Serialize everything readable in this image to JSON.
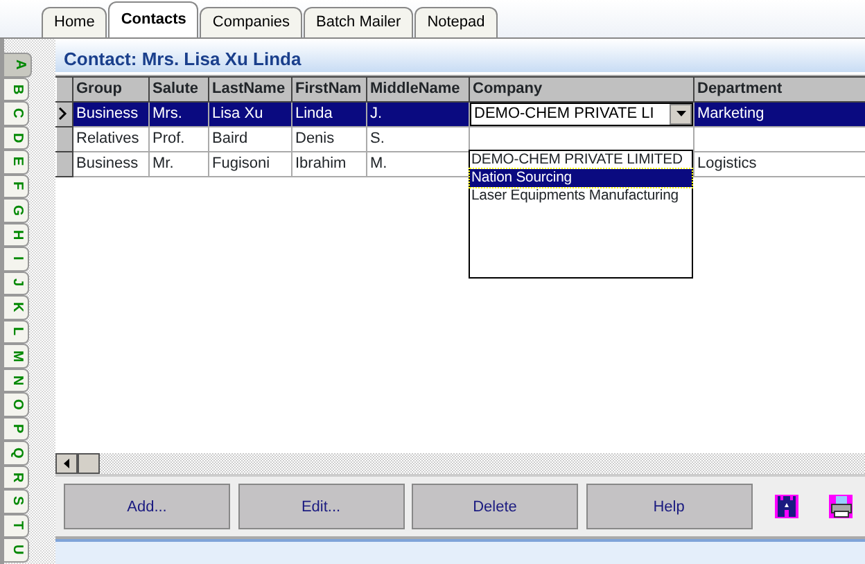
{
  "tabs": [
    {
      "label": "Home",
      "selected": false
    },
    {
      "label": "Contacts",
      "selected": true
    },
    {
      "label": "Companies",
      "selected": false
    },
    {
      "label": "Batch Mailer",
      "selected": false
    },
    {
      "label": "Notepad",
      "selected": false
    }
  ],
  "letters": [
    {
      "label": "A",
      "selected": true
    },
    {
      "label": "B",
      "selected": false
    },
    {
      "label": "C",
      "selected": false
    },
    {
      "label": "D",
      "selected": false
    },
    {
      "label": "E",
      "selected": false
    },
    {
      "label": "F",
      "selected": false
    },
    {
      "label": "G",
      "selected": false
    },
    {
      "label": "H",
      "selected": false
    },
    {
      "label": "I",
      "selected": false
    },
    {
      "label": "J",
      "selected": false
    },
    {
      "label": "K",
      "selected": false
    },
    {
      "label": "L",
      "selected": false
    },
    {
      "label": "M",
      "selected": false
    },
    {
      "label": "N",
      "selected": false
    },
    {
      "label": "O",
      "selected": false
    },
    {
      "label": "P",
      "selected": false
    },
    {
      "label": "Q",
      "selected": false
    },
    {
      "label": "R",
      "selected": false
    },
    {
      "label": "S",
      "selected": false
    },
    {
      "label": "T",
      "selected": false
    },
    {
      "label": "U",
      "selected": false
    }
  ],
  "header": {
    "title": "Contact: Mrs. Lisa Xu Linda"
  },
  "table": {
    "columns": [
      "Group",
      "Salute",
      "LastName",
      "FirstNam",
      "MiddleName",
      "Company",
      "Department"
    ],
    "rows": [
      {
        "selected": true,
        "group": "Business",
        "salute": "Mrs.",
        "last_name": "Lisa Xu",
        "first_name": "Linda",
        "middle_name": "J.",
        "department": "Marketing"
      },
      {
        "selected": false,
        "group": "Relatives",
        "salute": "Prof.",
        "last_name": "Baird",
        "first_name": "Denis",
        "middle_name": "S."
      },
      {
        "selected": false,
        "group": "Business",
        "salute": "Mr.",
        "last_name": "Fugisoni",
        "first_name": "Ibrahim",
        "middle_name": "M.",
        "department": "Logistics"
      }
    ],
    "company_editor": {
      "value": "DEMO-CHEM PRIVATE LI",
      "options": [
        {
          "label": "DEMO-CHEM PRIVATE LIMITED",
          "selected": false
        },
        {
          "label": "Nation Sourcing",
          "selected": true
        },
        {
          "label": "Laser Equipments Manufacturing",
          "selected": false
        }
      ]
    }
  },
  "buttons": [
    "Add...",
    "Edit...",
    "Delete",
    "Help"
  ]
}
